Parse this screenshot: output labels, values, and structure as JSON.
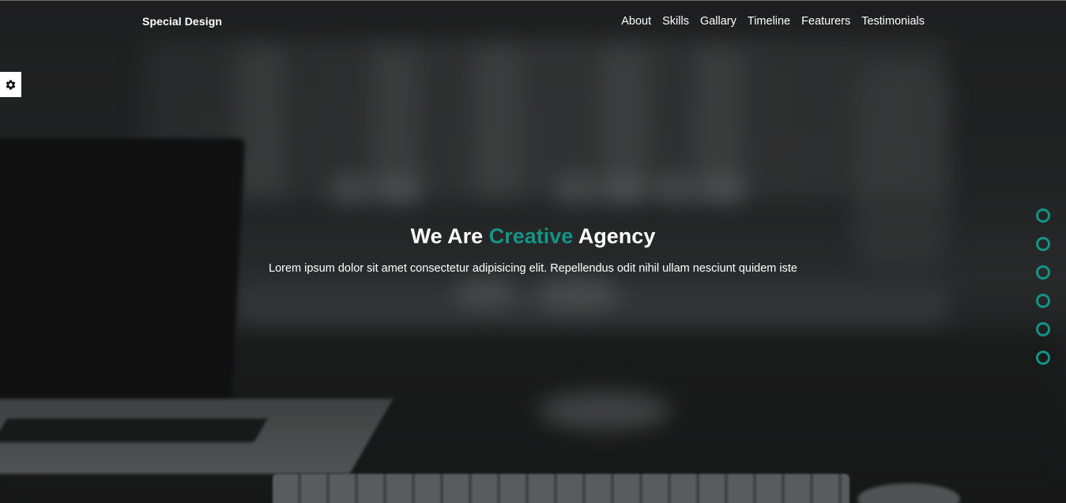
{
  "header": {
    "logo": "Special Design",
    "nav": [
      "About",
      "Skills",
      "Gallary",
      "Timeline",
      "Featurers",
      "Testimonials"
    ]
  },
  "hero": {
    "title_prefix": "We Are",
    "title_accent": "Creative",
    "title_suffix": "Agency",
    "description": "Lorem ipsum dolor sit amet consectetur adipisicing elit. Repellendus odit nihil ullam nesciunt quidem iste"
  },
  "settings": {
    "icon": "gear-icon"
  },
  "bullets": {
    "count": 6
  },
  "colors": {
    "accent": "#139486",
    "text": "#ffffff"
  }
}
